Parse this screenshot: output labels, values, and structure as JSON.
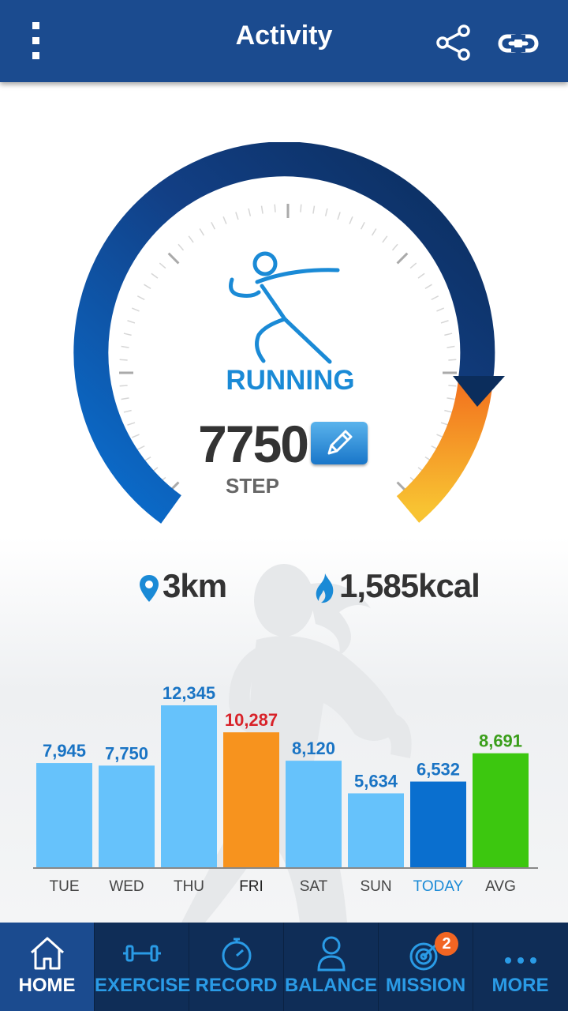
{
  "header": {
    "title": "Activity"
  },
  "activity": {
    "type_label": "RUNNING",
    "steps": "7750",
    "steps_unit": "STEP",
    "distance": "3km",
    "calories": "1,585kcal"
  },
  "chart_data": {
    "type": "bar",
    "categories": [
      "TUE",
      "WED",
      "THU",
      "FRI",
      "SAT",
      "SUN",
      "TODAY",
      "AVG"
    ],
    "values": [
      7945,
      7750,
      12345,
      10287,
      8120,
      5634,
      6532,
      8691
    ],
    "value_labels": [
      "7,945",
      "7,750",
      "12,345",
      "10,287",
      "8,120",
      "5,634",
      "6,532",
      "8,691"
    ],
    "colors": [
      "#66c2fb",
      "#66c2fb",
      "#66c2fb",
      "#f7931e",
      "#66c2fb",
      "#66c2fb",
      "#0a6fcf",
      "#3cc70f"
    ],
    "label_colors": [
      "#1a74c4",
      "#1a74c4",
      "#1a74c4",
      "#d8232a",
      "#1a74c4",
      "#1a74c4",
      "#1a74c4",
      "#3a9e1a"
    ],
    "category_colors": [
      "#444444",
      "#444444",
      "#444444",
      "#222222",
      "#444444",
      "#444444",
      "#1a8ad6",
      "#444444"
    ],
    "ylim": [
      0,
      12345
    ]
  },
  "nav": {
    "items": [
      {
        "label": "HOME",
        "icon": "home-icon"
      },
      {
        "label": "EXERCISE",
        "icon": "dumbbell-icon"
      },
      {
        "label": "RECORD",
        "icon": "stopwatch-icon"
      },
      {
        "label": "BALANCE",
        "icon": "person-icon"
      },
      {
        "label": "MISSION",
        "icon": "target-icon",
        "badge": "2"
      },
      {
        "label": "MORE",
        "icon": "more-icon"
      }
    ]
  }
}
